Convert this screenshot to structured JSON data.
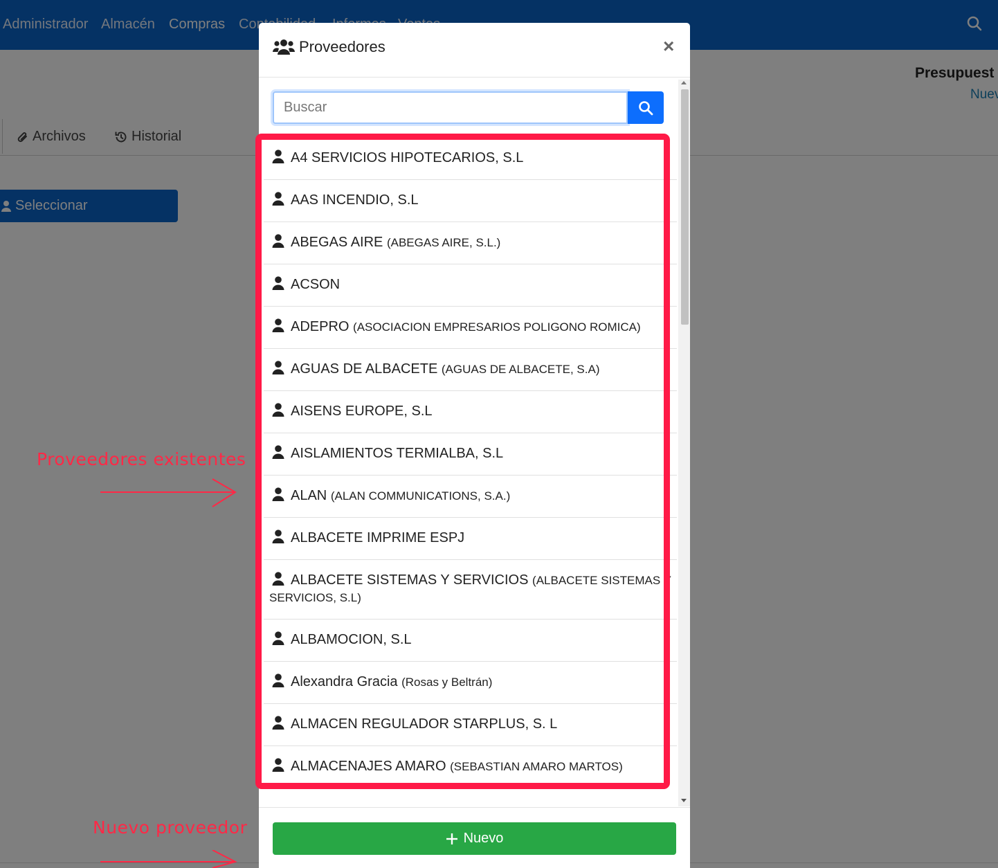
{
  "nav": {
    "items": [
      "Administrador",
      "Almacén",
      "Compras",
      "Contabilidad",
      "Informes",
      "Ventas"
    ]
  },
  "background": {
    "title": "Presupuest",
    "subtitle": "Nuev",
    "tabs": [
      "Archivos",
      "Historial"
    ],
    "select_button": "Seleccionar"
  },
  "modal": {
    "title": "Proveedores",
    "close": "×",
    "search": {
      "placeholder": "Buscar",
      "value": ""
    },
    "items": [
      {
        "name": "A4 SERVICIOS HIPOTECARIOS, S.L",
        "detail": ""
      },
      {
        "name": "AAS INCENDIO, S.L",
        "detail": ""
      },
      {
        "name": "ABEGAS AIRE",
        "detail": "(ABEGAS AIRE, S.L.)"
      },
      {
        "name": "ACSON",
        "detail": ""
      },
      {
        "name": "ADEPRO",
        "detail": "(ASOCIACION EMPRESARIOS POLIGONO ROMICA)"
      },
      {
        "name": "AGUAS DE ALBACETE",
        "detail": "(AGUAS DE ALBACETE, S.A)"
      },
      {
        "name": "AISENS EUROPE, S.L",
        "detail": ""
      },
      {
        "name": "AISLAMIENTOS TERMIALBA, S.L",
        "detail": ""
      },
      {
        "name": "ALAN",
        "detail": "(ALAN COMMUNICATIONS, S.A.)"
      },
      {
        "name": "ALBACETE IMPRIME ESPJ",
        "detail": ""
      },
      {
        "name": "ALBACETE SISTEMAS Y SERVICIOS",
        "detail": "(ALBACETE SISTEMAS Y SERVICIOS, S.L)"
      },
      {
        "name": "ALBAMOCION, S.L",
        "detail": ""
      },
      {
        "name": "Alexandra Gracia",
        "detail": "(Rosas y Beltrán)"
      },
      {
        "name": "ALMACEN REGULADOR STARPLUS, S. L",
        "detail": ""
      },
      {
        "name": "ALMACENAJES AMARO",
        "detail": "(SEBASTIAN AMARO MARTOS)"
      }
    ],
    "new_button": "Nuevo"
  },
  "annotations": {
    "existing": "Proveedores existentes",
    "new": "Nuevo proveedor"
  },
  "colors": {
    "nav": "#0b64c8",
    "highlight": "#ff1a47",
    "new_button": "#28a745",
    "search_button": "#0d6efd"
  }
}
